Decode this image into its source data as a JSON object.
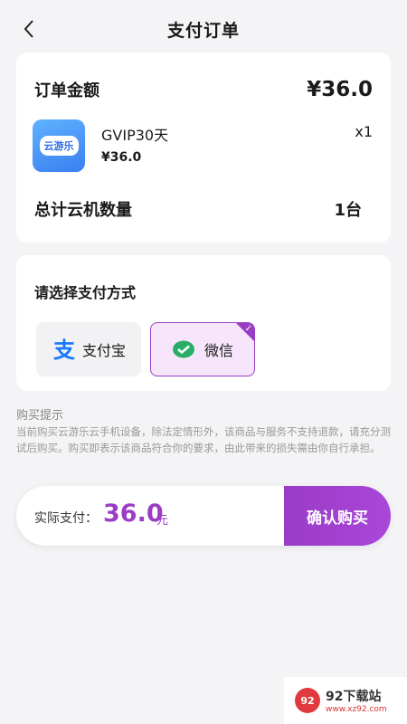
{
  "header": {
    "title": "支付订单",
    "back_icon": "chevron-left-icon"
  },
  "order": {
    "amount_label": "订单金额",
    "amount_value": "¥36.0",
    "product": {
      "icon_text": "云游乐",
      "name": "GVIP30天",
      "quantity": "x1",
      "price": "¥36.0"
    },
    "count_label": "总计云机数量",
    "count_value": "1台"
  },
  "payment": {
    "title": "请选择支付方式",
    "options": [
      {
        "label": "支付宝",
        "icon": "alipay-icon",
        "selected": false
      },
      {
        "label": "微信",
        "icon": "wechat-icon",
        "selected": true
      }
    ]
  },
  "tips": {
    "title": "购买提示",
    "text": "当前购买云游乐云手机设备，除法定情形外，该商品与服务不支持退款，请充分测试后购买。购买即表示该商品符合你的要求，由此带来的损失需由你自行承担。"
  },
  "paybar": {
    "label": "实际支付：",
    "amount": "36.0",
    "unit": "元",
    "confirm": "确认购买"
  },
  "watermark": {
    "name": "92下载站",
    "url": "www.xz92.com"
  },
  "colors": {
    "accent": "#9a3dc4",
    "alipay": "#1677ff",
    "wechat": "#2aae67"
  }
}
